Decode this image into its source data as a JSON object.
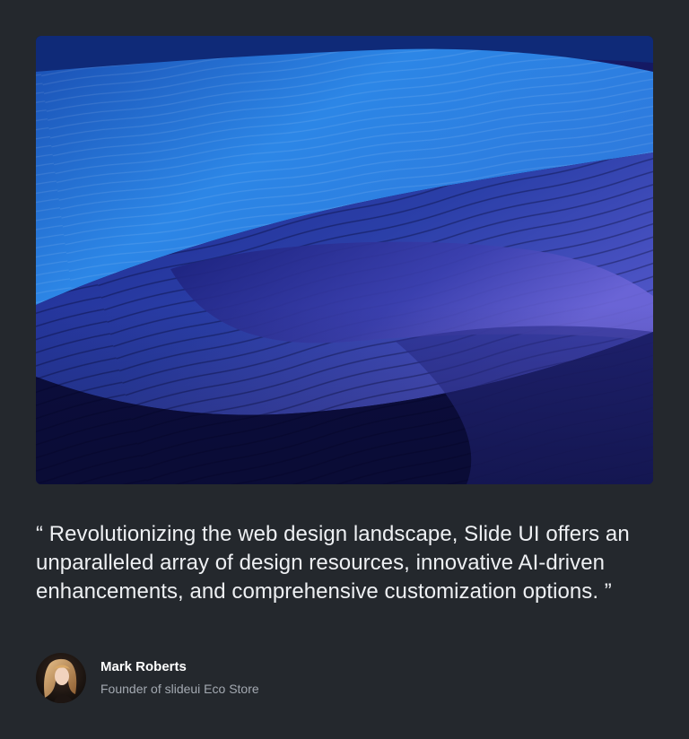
{
  "testimonial": {
    "image": {
      "alt": "",
      "icon": "sand-dunes-image"
    },
    "quote": "“ Revolutionizing the web design landscape, Slide UI offers an unparalleled array of design resources, innovative AI-driven enhancements, and comprehensive customization options. ”",
    "author": {
      "name": "Mark Roberts",
      "title": "Founder of slideui Eco Store",
      "avatar_icon": "user-avatar"
    }
  },
  "colors": {
    "background": "#24282d",
    "quote_text": "#eef0f3",
    "name_text": "#ffffff",
    "role_text": "#a3a9b1",
    "accent_blue": "#2a8be8",
    "deep_blue": "#101255"
  }
}
